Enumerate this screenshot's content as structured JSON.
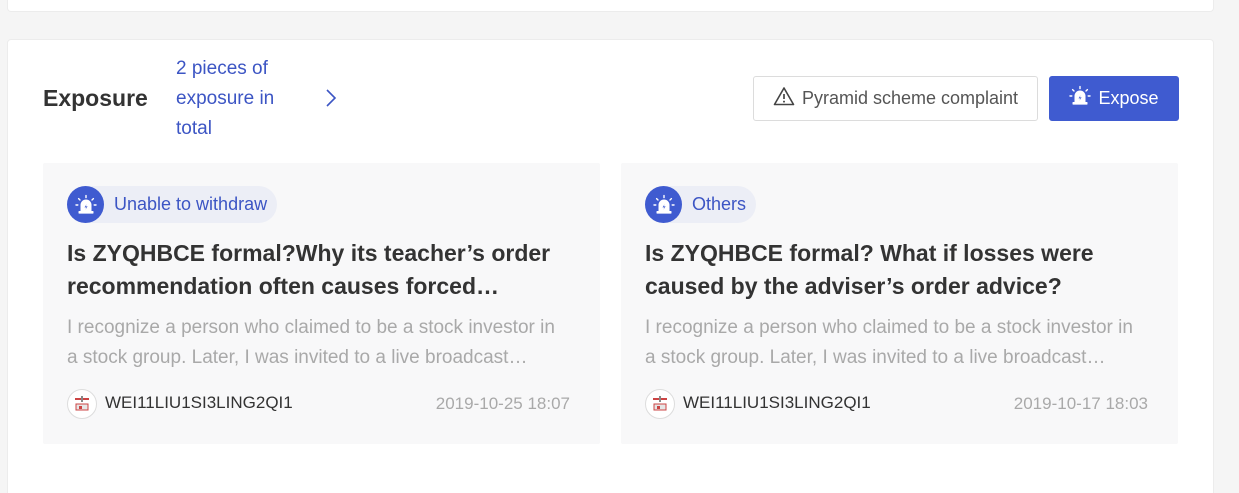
{
  "section": {
    "title": "Exposure",
    "count_link": "2 pieces of exposure in total"
  },
  "actions": {
    "complaint_label": "Pyramid scheme complaint",
    "expose_label": "Expose"
  },
  "colors": {
    "accent": "#3f5bd0",
    "link": "#3c55c4",
    "muted": "#a9a9a9",
    "card_bg": "#f8f8f9"
  },
  "icons": {
    "tag": "alarm-siren-icon",
    "complaint": "warning-triangle-icon",
    "expose": "alarm-siren-icon",
    "more": "chevron-right-icon"
  },
  "cards": [
    {
      "tag": "Unable to withdraw",
      "title": "Is ZYQHBCE formal?Why its teacher’s order recommendation often causes forced liquidation?",
      "excerpt": "I recognize a person who claimed to be a stock investor in a stock group. Later, I was invited to a live broadcast room where a teacher recommended orders.",
      "author": "WEI11LIU1SI3LING2QI1",
      "date": "2019-10-25 18:07"
    },
    {
      "tag": "Others",
      "title": "Is ZYQHBCE formal? What if losses were caused by the adviser’s order advice?",
      "excerpt": "I recognize a person who claimed to be a stock investor in a stock group. Later, I was invited to a live broadcast room where an adviser gave order advice.",
      "author": "WEI11LIU1SI3LING2QI1",
      "date": "2019-10-17 18:03"
    }
  ]
}
